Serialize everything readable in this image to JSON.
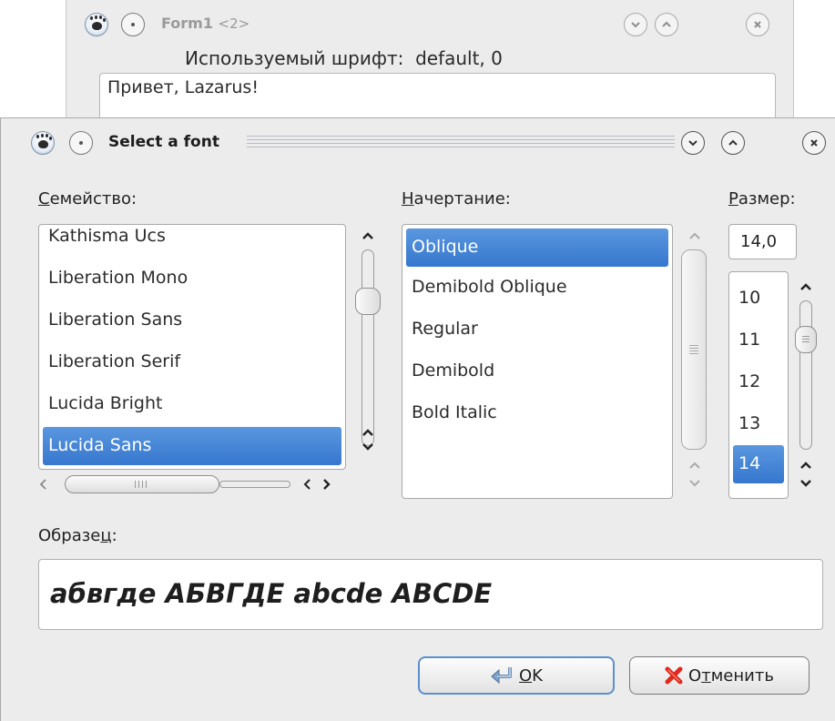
{
  "background_window": {
    "title": "Form1",
    "title_suffix": "<2>",
    "used_font_label": "Используемый шрифт:",
    "used_font_value": "default, 0",
    "textbox_value": "Привет, Lazarus!"
  },
  "dialog": {
    "title": "Select a font",
    "family": {
      "label_first": "С",
      "label_rest": "емейство:",
      "items": [
        {
          "label": "Kathisma Ucs"
        },
        {
          "label": "Liberation Mono"
        },
        {
          "label": "Liberation Sans"
        },
        {
          "label": "Liberation Serif"
        },
        {
          "label": "Lucida Bright"
        },
        {
          "label": "Lucida Sans"
        }
      ],
      "selected": "Lucida Sans"
    },
    "style": {
      "label_first": "Н",
      "label_rest": "ачертание:",
      "items": [
        {
          "label": "Oblique"
        },
        {
          "label": "Demibold Oblique"
        },
        {
          "label": "Regular"
        },
        {
          "label": "Demibold"
        },
        {
          "label": "Bold Italic"
        }
      ],
      "selected": "Oblique"
    },
    "size": {
      "label_first": "Р",
      "label_rest": "азмер:",
      "value": "14,0",
      "items": [
        {
          "label": "10"
        },
        {
          "label": "11"
        },
        {
          "label": "12"
        },
        {
          "label": "13"
        },
        {
          "label": "14"
        }
      ],
      "selected": "14"
    },
    "sample": {
      "label_before": "Образе",
      "label_underlined": "ц",
      "label_after": ":",
      "text": "абвгде АБВГДЕ abcde ABCDE"
    },
    "buttons": {
      "ok_underlined": "O",
      "ok_rest": "K",
      "cancel_before": "О",
      "cancel_underlined": "т",
      "cancel_after": "менить"
    }
  },
  "icons": {
    "app_icon": "paw-icon",
    "sticky": "pin-dot-icon",
    "minimize": "chevron-down-icon",
    "maximize": "chevron-up-icon",
    "close": "close-icon",
    "ok_icon": "enter-arrow-icon",
    "cancel_icon": "red-x-icon"
  },
  "colors": {
    "selection": "#3e81d4",
    "cancel_icon": "#e0281c"
  }
}
